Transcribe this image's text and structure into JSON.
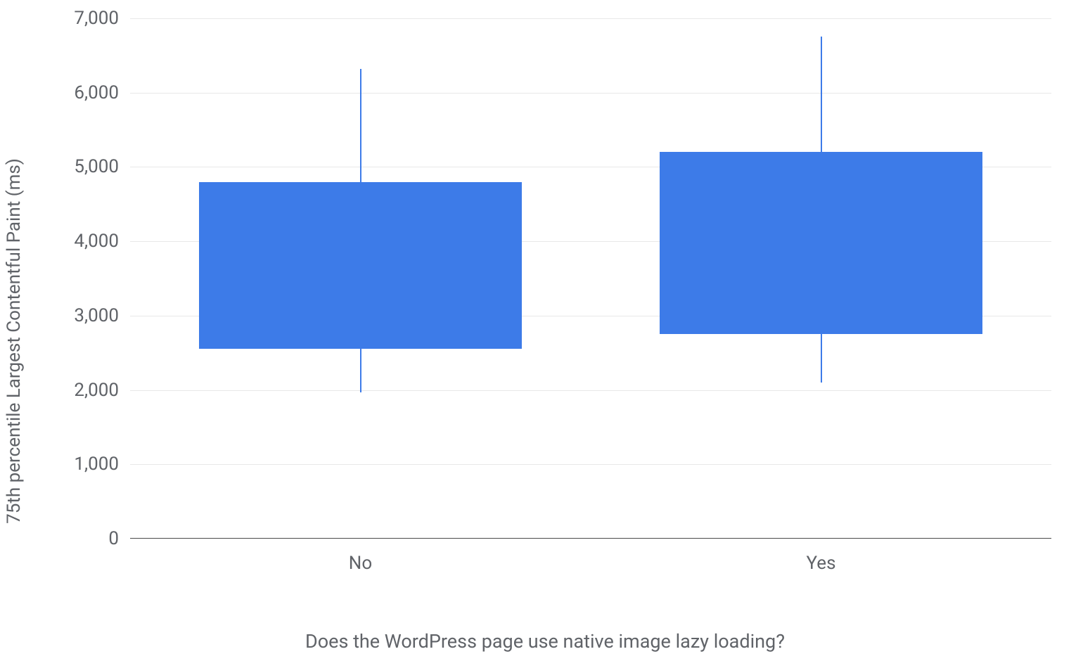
{
  "chart_data": {
    "type": "boxplot",
    "ylabel": "75th percentile Largest Contentful Paint (ms)",
    "xlabel": "Does the WordPress page use native image lazy loading?",
    "ylim": [
      0,
      7000
    ],
    "y_ticks": [
      0,
      1000,
      2000,
      3000,
      4000,
      5000,
      6000,
      7000
    ],
    "y_tick_labels": [
      "0",
      "1,000",
      "2,000",
      "3,000",
      "4,000",
      "5,000",
      "6,000",
      "7,000"
    ],
    "categories": [
      "No",
      "Yes"
    ],
    "series": [
      {
        "name": "No",
        "whisker_low": 1970,
        "q1": 2550,
        "q3": 4800,
        "whisker_high": 6320
      },
      {
        "name": "Yes",
        "whisker_low": 2100,
        "q1": 2750,
        "q3": 5200,
        "whisker_high": 6750
      }
    ],
    "box_color": "#3d7be8"
  }
}
